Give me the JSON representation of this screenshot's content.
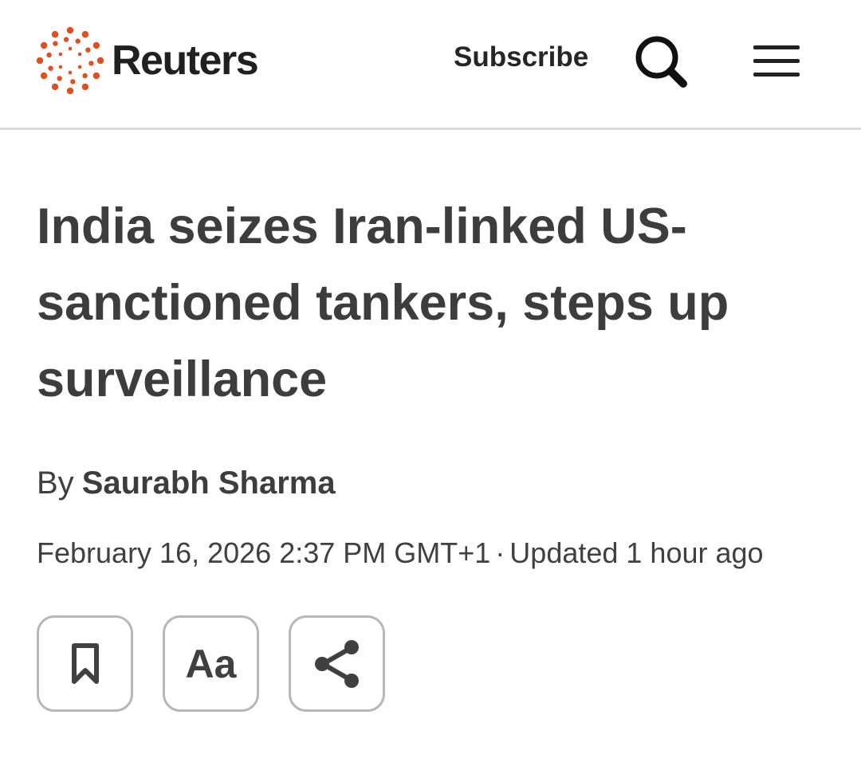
{
  "header": {
    "brand": "Reuters",
    "subscribe_label": "Subscribe",
    "search_icon": "search-icon",
    "menu_icon": "hamburger-menu-icon",
    "brand_color": "#e0501f"
  },
  "article": {
    "headline": "India seizes Iran-linked US-sanctioned tankers, steps up surveillance",
    "byline_prefix": "By",
    "author": "Saurabh Sharma",
    "published": "February 16, 2026 2:37 PM GMT+1",
    "separator": "·",
    "updated": "Updated 1 hour ago"
  },
  "actions": {
    "bookmark_icon": "bookmark-icon",
    "text_size_label": "Aa",
    "share_icon": "share-icon"
  }
}
